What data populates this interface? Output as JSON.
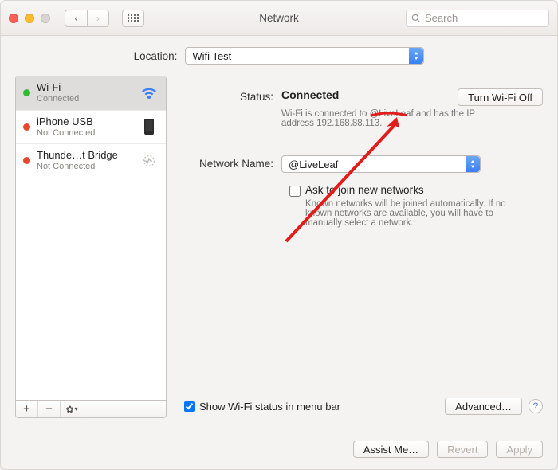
{
  "window": {
    "title": "Network"
  },
  "search": {
    "placeholder": "Search"
  },
  "location": {
    "label": "Location:",
    "value": "Wifi Test"
  },
  "sidebar": {
    "items": [
      {
        "name": "Wi-Fi",
        "sub": "Connected",
        "status": "green",
        "icon": "wifi",
        "selected": true
      },
      {
        "name": "iPhone USB",
        "sub": "Not Connected",
        "status": "red",
        "icon": "phone"
      },
      {
        "name": "Thunde…t Bridge",
        "sub": "Not Connected",
        "status": "red",
        "icon": "thunderbolt"
      }
    ]
  },
  "main": {
    "status_label": "Status:",
    "status_value": "Connected",
    "turn_off": "Turn Wi-Fi Off",
    "status_desc": "Wi-Fi is connected to @LiveLeaf and has the IP address 192.168.88.113.",
    "network_name_label": "Network Name:",
    "network_name_value": "@LiveLeaf",
    "ask_join": "Ask to join new networks",
    "ask_join_help": "Known networks will be joined automatically. If no known networks are available, you will have to manually select a network.",
    "show_menu": "Show Wi-Fi status in menu bar",
    "advanced": "Advanced…"
  },
  "buttons": {
    "assist": "Assist Me…",
    "revert": "Revert",
    "apply": "Apply"
  }
}
